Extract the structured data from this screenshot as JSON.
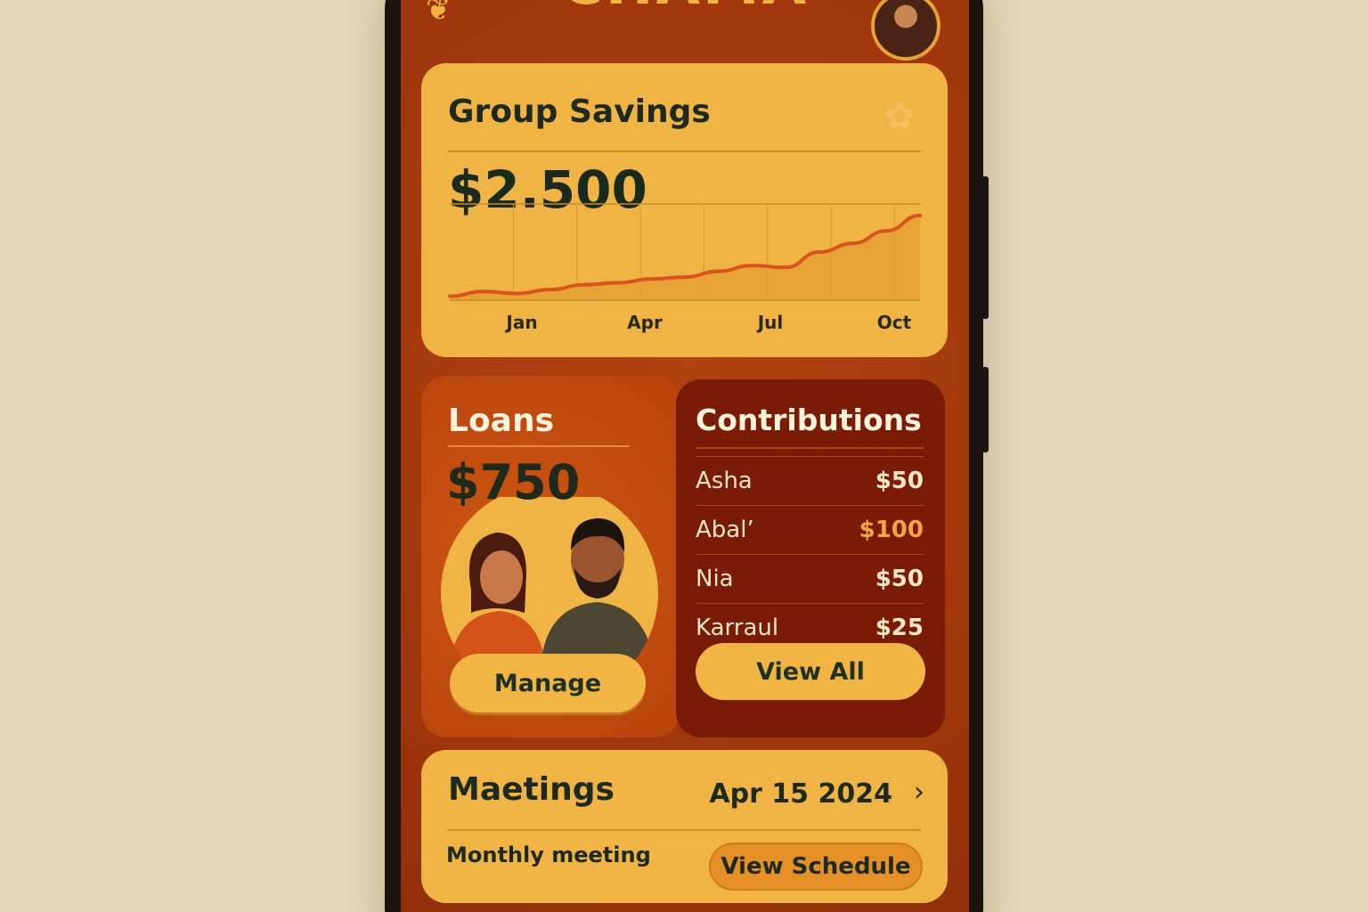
{
  "app": {
    "title": "CHAMA"
  },
  "savings": {
    "title": "Group Savings",
    "amount": "$2.500"
  },
  "chart_data": {
    "type": "area",
    "x_ticks": [
      "Jan",
      "Apr",
      "Jul",
      "Oct"
    ],
    "x": [
      0,
      1,
      2,
      3,
      4,
      5,
      6,
      7,
      8,
      9,
      10,
      11,
      12,
      13,
      14
    ],
    "values": [
      4,
      9,
      7,
      11,
      16,
      18,
      22,
      24,
      30,
      36,
      34,
      50,
      59,
      72,
      88
    ],
    "ylim": [
      0,
      100
    ],
    "title": "",
    "xlabel": "",
    "ylabel": "",
    "grid": true
  },
  "loans": {
    "title": "Loans",
    "amount": "$750",
    "button": "Manage"
  },
  "contributions": {
    "title": "Contributions",
    "rows": [
      {
        "name": "Asha",
        "amount": "$50",
        "highlight": false
      },
      {
        "name": "Abal’",
        "amount": "$100",
        "highlight": true
      },
      {
        "name": "Nia",
        "amount": "$50",
        "highlight": false
      },
      {
        "name": "Karraul",
        "amount": "$25",
        "highlight": false
      }
    ],
    "button": "View All"
  },
  "meetings": {
    "title": "Maetings",
    "date": "Apr 15 2024",
    "subtitle": "Monthly meeting",
    "button": "View Schedule"
  },
  "colors": {
    "background": "#e4d6b8",
    "screen": "#a83a0c",
    "card": "#f0b445",
    "accent_line": "#d9541a",
    "contributions_card": "#7a1b05"
  }
}
